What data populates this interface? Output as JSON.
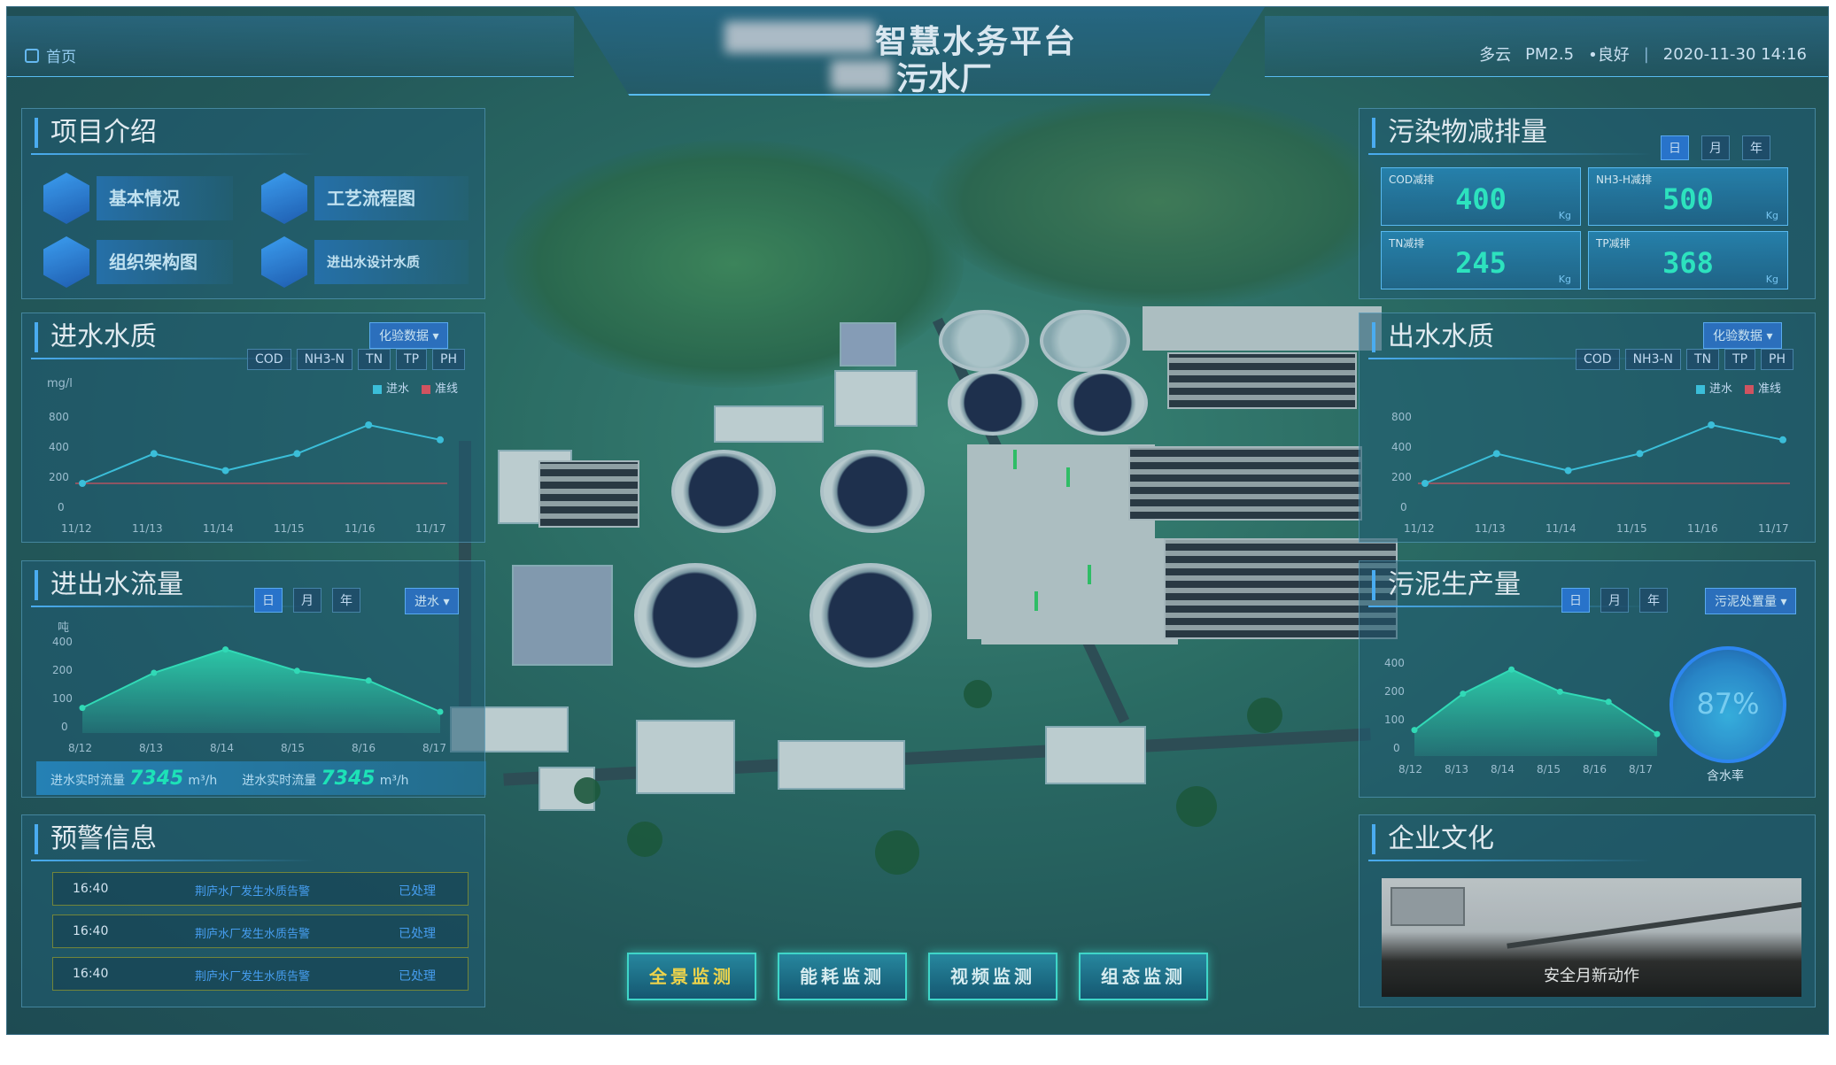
{
  "header": {
    "title_line1": "智慧水务平台",
    "title_line2": "污水厂",
    "home_label": "首页",
    "weather": "多云",
    "pm_label": "PM2.5",
    "air_quality": "•良好",
    "datetime": "2020-11-30  14:16"
  },
  "project_intro": {
    "title": "项目介绍",
    "buttons": [
      {
        "label": "基本情况",
        "icon": "document-icon"
      },
      {
        "label": "工艺流程图",
        "icon": "org-chart-icon"
      },
      {
        "label": "组织架构图",
        "icon": "layers-icon"
      },
      {
        "label": "进出水设计水质",
        "icon": "water-drop-icon"
      }
    ]
  },
  "inflow_quality": {
    "title": "进水水质",
    "dropdown": "化验数据 ▾",
    "tabs": [
      "COD",
      "NH3-N",
      "TN",
      "TP",
      "PH"
    ],
    "unit": "mg/l",
    "legend": [
      "进水",
      "准线"
    ],
    "legend_colors": [
      "#3ec9e6",
      "#e05563"
    ],
    "y_ticks": [
      "800",
      "400",
      "200",
      "0"
    ],
    "x_ticks": [
      "11/12",
      "11/13",
      "11/14",
      "11/15",
      "11/16",
      "11/17"
    ]
  },
  "flow": {
    "title": "进出水流量",
    "tabs": [
      "日",
      "月",
      "年"
    ],
    "dropdown": "进水 ▾",
    "unit": "吨",
    "y_ticks": [
      "400",
      "200",
      "100",
      "0"
    ],
    "x_ticks": [
      "8/12",
      "8/13",
      "8/14",
      "8/15",
      "8/16",
      "8/17"
    ],
    "bar_label1": "进水实时流量",
    "bar_value1": "7345",
    "bar_unit1": "m³/h",
    "bar_label2": "进水实时流量",
    "bar_value2": "7345",
    "bar_unit2": "m³/h"
  },
  "alerts": {
    "title": "预警信息",
    "rows": [
      {
        "time": "16:40",
        "msg": "荆庐水厂发生水质告警",
        "status": "已处理"
      },
      {
        "time": "16:40",
        "msg": "荆庐水厂发生水质告警",
        "status": "已处理"
      },
      {
        "time": "16:40",
        "msg": "荆庐水厂发生水质告警",
        "status": "已处理"
      }
    ]
  },
  "pollutant": {
    "title": "污染物减排量",
    "tabs": [
      "日",
      "月",
      "年"
    ],
    "stats": [
      {
        "label": "COD减排",
        "value": "400",
        "unit": "Kg"
      },
      {
        "label": "NH3-H减排",
        "value": "500",
        "unit": "Kg"
      },
      {
        "label": "TN减排",
        "value": "245",
        "unit": "Kg"
      },
      {
        "label": "TP减排",
        "value": "368",
        "unit": "Kg"
      }
    ]
  },
  "outflow_quality": {
    "title": "出水水质",
    "dropdown": "化验数据 ▾",
    "tabs": [
      "COD",
      "NH3-N",
      "TN",
      "TP",
      "PH"
    ],
    "legend": [
      "进水",
      "准线"
    ],
    "y_ticks": [
      "800",
      "400",
      "200",
      "0"
    ],
    "x_ticks": [
      "11/12",
      "11/13",
      "11/14",
      "11/15",
      "11/16",
      "11/17"
    ]
  },
  "sludge": {
    "title": "污泥生产量",
    "tabs": [
      "日",
      "月",
      "年"
    ],
    "dropdown": "污泥处置量 ▾",
    "y_ticks": [
      "400",
      "200",
      "100",
      "0"
    ],
    "x_ticks": [
      "8/12",
      "8/13",
      "8/14",
      "8/15",
      "8/16",
      "8/17"
    ],
    "gauge_value": "87%",
    "gauge_label": "含水率"
  },
  "culture": {
    "title": "企业文化",
    "caption": "安全月新动作"
  },
  "nav": [
    "全景监测",
    "能耗监测",
    "视频监测",
    "组态监测"
  ],
  "chart_data": [
    {
      "type": "line",
      "title": "进水水质",
      "x": [
        "11/12",
        "11/13",
        "11/14",
        "11/15",
        "11/16",
        "11/17"
      ],
      "series": [
        {
          "name": "进水",
          "values": [
            200,
            480,
            320,
            480,
            750,
            610
          ]
        }
      ],
      "threshold": 200,
      "ylabel": "mg/l",
      "ylim": [
        0,
        1000
      ]
    },
    {
      "type": "area",
      "title": "进出水流量",
      "x": [
        "8/12",
        "8/13",
        "8/14",
        "8/15",
        "8/16",
        "8/17"
      ],
      "series": [
        {
          "values": [
            120,
            300,
            420,
            310,
            260,
            100
          ]
        }
      ],
      "ylabel": "吨",
      "ylim": [
        0,
        500
      ]
    },
    {
      "type": "line",
      "title": "出水水质",
      "x": [
        "11/12",
        "11/13",
        "11/14",
        "11/15",
        "11/16",
        "11/17"
      ],
      "series": [
        {
          "name": "进水",
          "values": [
            200,
            480,
            320,
            480,
            750,
            610
          ]
        }
      ],
      "threshold": 200,
      "ylim": [
        0,
        1000
      ]
    },
    {
      "type": "area",
      "title": "污泥生产量",
      "x": [
        "8/12",
        "8/13",
        "8/14",
        "8/15",
        "8/16",
        "8/17"
      ],
      "series": [
        {
          "values": [
            120,
            300,
            420,
            310,
            260,
            100
          ]
        }
      ],
      "ylim": [
        0,
        500
      ]
    }
  ]
}
